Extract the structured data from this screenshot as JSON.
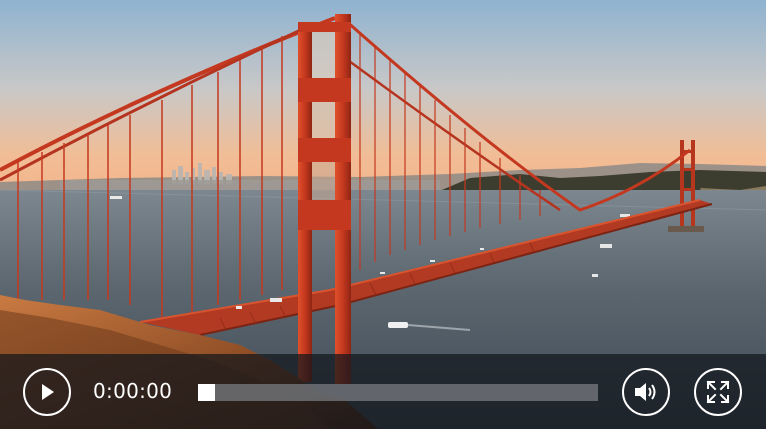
{
  "video": {
    "scene": "golden-gate-bridge-sunset"
  },
  "controls": {
    "play_icon": "play-icon",
    "current_time": "0:00:00",
    "progress": 0,
    "volume_icon": "volume-icon",
    "fullscreen_icon": "fullscreen-icon"
  },
  "colors": {
    "bridge": "#c4381f",
    "sky_top": "#8fb3d0",
    "sky_horizon": "#f4b48a",
    "water": "#4d5963",
    "control_bar": "#12161c",
    "control_fg": "#ffffff",
    "progress_track": "#787c82"
  }
}
